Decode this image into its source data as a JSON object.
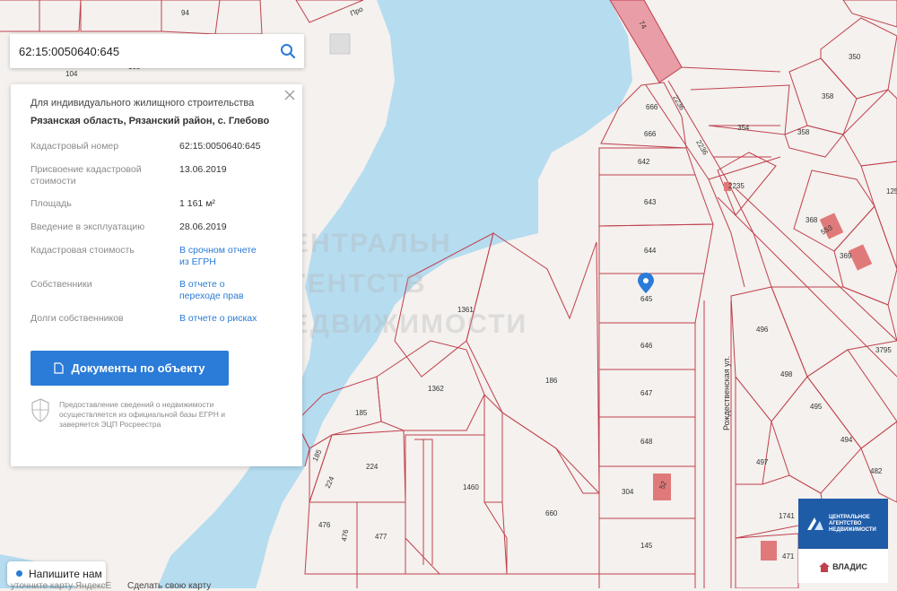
{
  "search": {
    "value": "62:15:0050640:645"
  },
  "card": {
    "purpose": "Для индивидуального жилищного строительства",
    "address": "Рязанская область, Рязанский район, с. Глебово",
    "rows": [
      {
        "label": "Кадастровый номер",
        "value": "62:15:0050640:645"
      },
      {
        "label": "Присвоение кадастровой стоимости",
        "value": "13.06.2019"
      },
      {
        "label": "Площадь",
        "value": "1 161 м²"
      },
      {
        "label": "Введение в эксплуатацию",
        "value": "28.06.2019"
      },
      {
        "label": "Кадастровая стоимость",
        "value": "В срочном отчете из ЕГРН"
      },
      {
        "label": "Собственники",
        "value": "В отчете о переходе прав"
      },
      {
        "label": "Долги собственников",
        "value": "В отчете о рисках"
      }
    ],
    "documents_button": "Документы по объекту",
    "disclaimer": "Предоставление сведений о недвижимости осуществляется из официальной базы ЕГРН и заверяется ЭЦП Росреестра"
  },
  "map": {
    "watermark_lines": [
      "ЦЕНТРАЛЬН",
      "АГЕНТСТВ",
      "НЕДВИЖИМОСТИ"
    ],
    "street_label": "Рождественская ул.",
    "road_top_label": "Про",
    "parcels": [
      "94",
      "103",
      "104",
      "74",
      "350",
      "358",
      "358",
      "354",
      "2236",
      "2235",
      "2235",
      "666",
      "666",
      "642",
      "643",
      "644",
      "645",
      "646",
      "647",
      "648",
      "304",
      "145",
      "1361",
      "1362",
      "186",
      "185",
      "185",
      "224",
      "224",
      "476",
      "476",
      "477",
      "1460",
      "660",
      "368",
      "369",
      "125",
      "496",
      "498",
      "495",
      "494",
      "482",
      "497",
      "1741",
      "471",
      "3795",
      "553",
      "52"
    ],
    "marker_icon": "location-pin-icon"
  },
  "chat": {
    "label": "Напишите нам"
  },
  "bottom_links": [
    "Сделать свою карту"
  ],
  "bottom_partial": "уточните карту ЯндексЕ",
  "logo": {
    "agency_lines": [
      "ЦЕНТРАЛЬНОЕ",
      "АГЕНТСТВО",
      "НЕДВИЖИМОСТИ"
    ],
    "partner": "ВЛАДИС"
  },
  "colors": {
    "accent": "#2b7bd8",
    "parcel_line": "#c0414d",
    "water": "#b6dcf0",
    "logo_blue": "#1f5ca8"
  }
}
